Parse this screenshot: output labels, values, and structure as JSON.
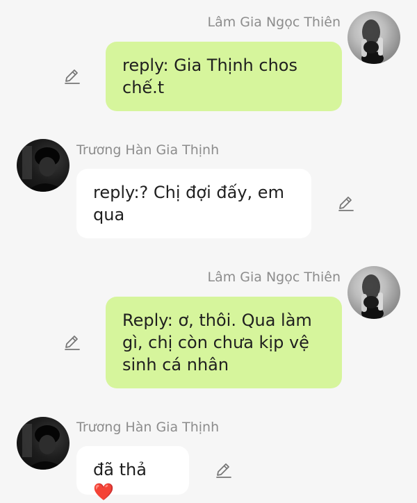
{
  "messages": [
    {
      "direction": "out",
      "sender": "Lâm Gia Ngọc Thiên",
      "text": "reply: Gia Thịnh chos chế.t",
      "avatar_icon": "profile-photo-girl"
    },
    {
      "direction": "in",
      "sender": "Trương Hàn Gia Thịnh",
      "text": "reply:? Chị đợi đấy, em qua",
      "avatar_icon": "profile-photo-boy"
    },
    {
      "direction": "out",
      "sender": "Lâm Gia Ngọc Thiên",
      "text": "Reply: ơ, thôi. Qua làm gì, chị còn chưa kịp vệ sinh cá nhân",
      "avatar_icon": "profile-photo-girl"
    },
    {
      "direction": "in",
      "sender": "Trương Hàn Gia Thịnh",
      "text": "đã thả",
      "emoji": "❤️",
      "avatar_icon": "profile-photo-boy"
    }
  ],
  "colors": {
    "background": "#f6f6f6",
    "outgoing_bubble": "#d6f59c",
    "incoming_bubble": "#ffffff",
    "sender_name": "#8c8c8c",
    "heart": "#d8202a"
  },
  "icons": {
    "edit": "pencil-icon"
  }
}
